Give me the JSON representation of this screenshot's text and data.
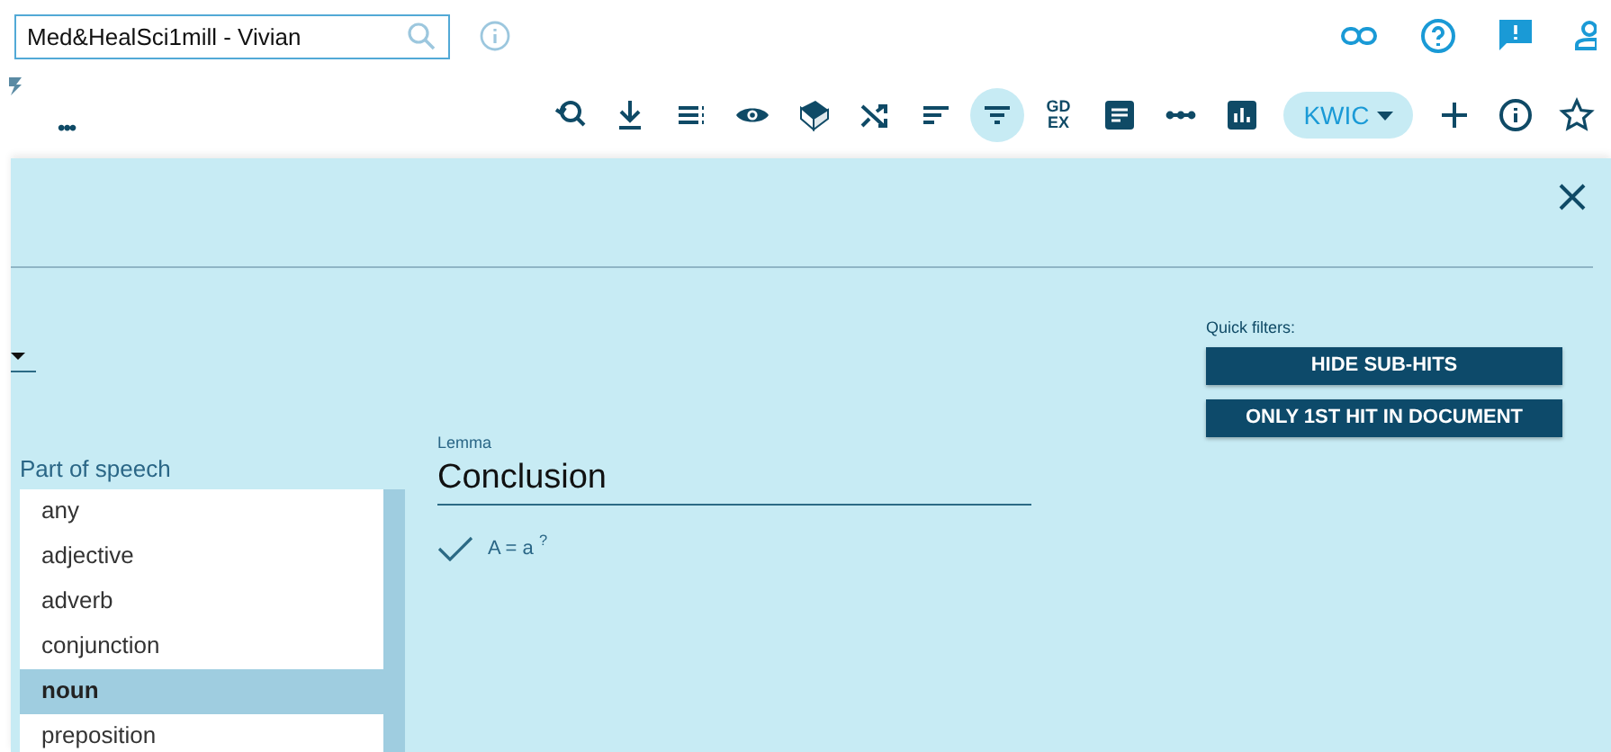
{
  "corpus_search": {
    "value": "Med&HealSci1mill - Vivian"
  },
  "more_menu": "•••",
  "toolbar": [
    {
      "kind": "icon",
      "selected": false
    },
    {
      "kind": "icon",
      "selected": false
    },
    {
      "kind": "icon",
      "selected": false
    },
    {
      "kind": "icon",
      "selected": false
    },
    {
      "kind": "icon",
      "selected": false
    },
    {
      "kind": "icon",
      "selected": false
    },
    {
      "kind": "icon",
      "selected": false
    },
    {
      "kind": "icon",
      "selected": true
    },
    {
      "kind": "text",
      "label": "GD EX",
      "selected": false
    },
    {
      "kind": "icon",
      "selected": false
    },
    {
      "kind": "icon",
      "selected": false
    },
    {
      "kind": "icon",
      "selected": false
    },
    {
      "kind": "dropdown",
      "label": "KWIC",
      "selected": false
    },
    {
      "kind": "icon",
      "selected": false
    },
    {
      "kind": "icon",
      "selected": false
    },
    {
      "kind": "icon",
      "selected": false
    }
  ],
  "quick_filters": {
    "label": "Quick filters:",
    "buttons": [
      "HIDE SUB-HITS",
      "ONLY 1ST HIT IN DOCUMENT"
    ]
  },
  "part_of_speech": {
    "label": "Part of speech",
    "items": [
      {
        "label": "any",
        "selected": false
      },
      {
        "label": "adjective",
        "selected": false
      },
      {
        "label": "adverb",
        "selected": false
      },
      {
        "label": "conjunction",
        "selected": false
      },
      {
        "label": "noun",
        "selected": true
      },
      {
        "label": "preposition",
        "selected": false
      }
    ]
  },
  "lemma": {
    "label": "Lemma",
    "value": "Conclusion",
    "match_case": {
      "checked": true,
      "label": "A = a",
      "help": "?"
    }
  }
}
